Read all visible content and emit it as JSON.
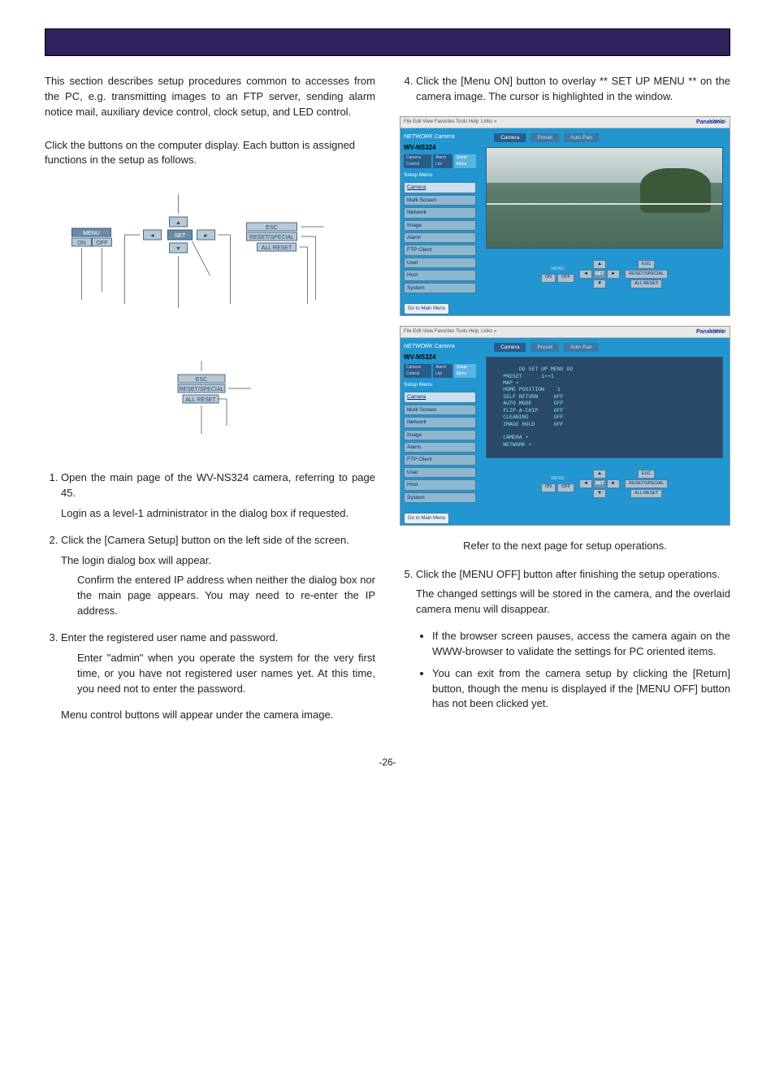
{
  "header": {
    "title": ""
  },
  "leftCol": {
    "intro": "This section describes setup procedures common to accesses from the PC, e.g. transmitting images to an FTP server, sending alarm notice mail, auxiliary device control, clock setup, and LED control.",
    "navCaption": "Click the buttons on the computer display. Each button is assigned functions in the setup as follows.",
    "diagram": {
      "menu_label": "MENU",
      "on": "ON",
      "off": "OFF",
      "set": "SET",
      "esc": "ESC",
      "reset": "RESET/SPECIAL",
      "allreset": "ALL RESET",
      "arrow_up": "▲",
      "arrow_down": "▼",
      "arrow_left": "◄",
      "arrow_right": "►"
    },
    "detail": {
      "esc": "ESC",
      "reset": "RESET/SPECIAL",
      "allreset": "ALL RESET"
    },
    "steps": [
      {
        "num": "1",
        "text": "Open the main page of the WV-NS324 camera, referring to page 45.",
        "sub": "Login as a level-1 administrator in the dialog box if requested."
      },
      {
        "num": "2",
        "text": "Click the [Camera Setup] button on the left side of the screen.",
        "sub": "The login dialog box will appear.",
        "indent": "Confirm the entered IP address when neither the dialog box nor the main page appears. You may need to re-enter the IP address."
      },
      {
        "num": "3",
        "text": "Enter the registered user name and password.",
        "indent": "Enter \"admin\" when you operate the system for the very first time, or you have not registered user names yet. At this time, you need not to enter the password.",
        "post": "Menu control buttons will appear under the camera image."
      }
    ]
  },
  "rightCol": {
    "step4": "Click the [Menu ON] button to overlay ** SET UP MENU ** on the camera image. The cursor is highlighted in the window.",
    "refer": "Refer to the next page for setup operations.",
    "step5": {
      "text": "Click the [MENU OFF] button after finishing the setup operations.",
      "sub": "The changed settings will be stored in the camera, and the overlaid camera menu will disappear."
    },
    "bullets": [
      "If the browser screen pauses, access the camera again on the WWW-browser to validate the settings for PC oriented items.",
      "You can exit from the camera setup by clicking the [Return] button, though the menu is displayed if the [MENU OFF] button has not been clicked yet."
    ]
  },
  "screenshot": {
    "toolbar": {
      "menu": "File  Edit  View  Favorites  Tools  Help",
      "links": "Links »",
      "address": "Address"
    },
    "brand": "Panasonic",
    "sidebar": {
      "logo": "NETWORK Camera",
      "model": "WV-NS324",
      "tabs": [
        "Camera Control",
        "Alarm List",
        "Setup Menu"
      ],
      "title": "Setup Menu",
      "items": [
        "Camera",
        "Multi Screen",
        "Network",
        "Image",
        "Alarm",
        "FTP Client",
        "User",
        "Host",
        "System"
      ],
      "goto": "Go to Main Menu"
    },
    "mainTabs": [
      "Camera",
      "Preset",
      "Auto Pan"
    ],
    "overlay_text": "     OO SET UP MENU OO\nPRESET      1••1\nMAP •\nHOME POSITION    1\nSELF RETURN     OFF\nAUTO MODE       OFF\nFLIP-A-CHIP     OFF\nCLEANING        OFF\nIMAGE HOLD      OFF\n\nCAMERA •\nNETWORK •",
    "controls": {
      "menu_label": "MENU",
      "on": "ON",
      "off": "OFF",
      "up": "▲",
      "down": "▼",
      "left": "◄",
      "right": "►",
      "set": "SET",
      "esc": "ESC",
      "reset": "RESET/SPECIAL",
      "allreset": "ALL RESET"
    }
  },
  "pageNumber": "-26-"
}
